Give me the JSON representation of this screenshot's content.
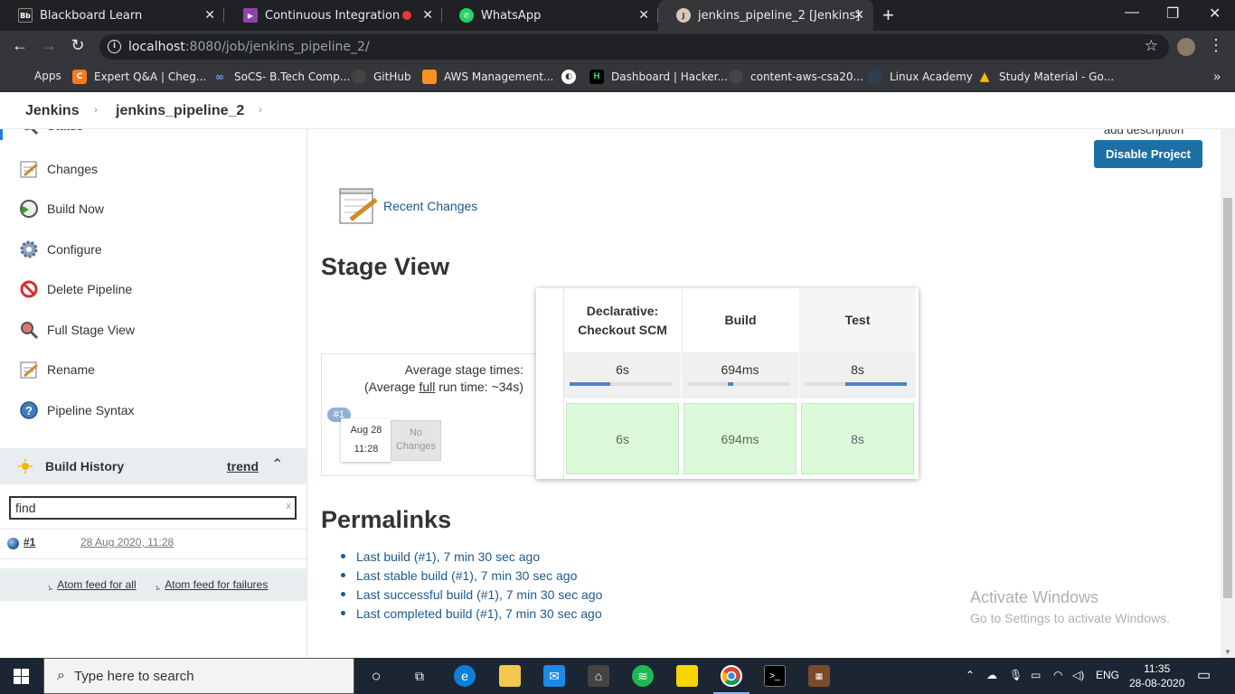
{
  "browser": {
    "tabs": [
      {
        "title": "Blackboard Learn",
        "favicon": "Bb"
      },
      {
        "title": "Continuous Integration & De",
        "favicon": ""
      },
      {
        "title": "WhatsApp",
        "favicon": ""
      },
      {
        "title": "jenkins_pipeline_2 [Jenkins]",
        "favicon": ""
      }
    ],
    "url_host": "localhost",
    "url_rest": ":8080/job/jenkins_pipeline_2/",
    "bookmarks": [
      {
        "label": "Apps"
      },
      {
        "label": "Expert Q&A | Cheg..."
      },
      {
        "label": "SoCS- B.Tech Comp..."
      },
      {
        "label": "GitHub"
      },
      {
        "label": "AWS Management..."
      },
      {
        "label": ""
      },
      {
        "label": "Dashboard | Hacker..."
      },
      {
        "label": "content-aws-csa20..."
      },
      {
        "label": "Linux Academy"
      },
      {
        "label": "Study Material - Go..."
      }
    ]
  },
  "breadcrumb": {
    "root": "Jenkins",
    "job": "jenkins_pipeline_2"
  },
  "sidebar": {
    "items": [
      {
        "label": "Status"
      },
      {
        "label": "Changes"
      },
      {
        "label": "Build Now"
      },
      {
        "label": "Configure"
      },
      {
        "label": "Delete Pipeline"
      },
      {
        "label": "Full Stage View"
      },
      {
        "label": "Rename"
      },
      {
        "label": "Pipeline Syntax"
      }
    ],
    "build_history": {
      "title": "Build History",
      "trend": "trend",
      "find_value": "find",
      "clear": "x",
      "builds": [
        {
          "number": "#1",
          "date": "28 Aug 2020, 11:28"
        }
      ],
      "feed_all": "Atom feed for all",
      "feed_failures": "Atom feed for failures"
    }
  },
  "main": {
    "add_description": "add description",
    "disable_button": "Disable Project",
    "recent_changes": "Recent Changes",
    "stage_view_title": "Stage View",
    "avg_line1": "Average stage times:",
    "avg_line2_a": "(Average ",
    "avg_line2_u": "full",
    "avg_line2_b": " run time: ~34s)",
    "stages": [
      {
        "name_l1": "Declarative:",
        "name_l2": "Checkout SCM",
        "avg": "6s",
        "avg_fraction": 0.4,
        "cell": "6s"
      },
      {
        "name_l1": "Build",
        "name_l2": "",
        "avg": "694ms",
        "avg_fraction": 0.05,
        "cell": "694ms"
      },
      {
        "name_l1": "Test",
        "name_l2": "",
        "avg": "8s",
        "avg_fraction": 0.6,
        "cell": "8s"
      }
    ],
    "run": {
      "badge": "#1",
      "date": "Aug 28",
      "time": "11:28",
      "changes_l1": "No",
      "changes_l2": "Changes"
    },
    "permalinks_title": "Permalinks",
    "permalinks": [
      "Last build (#1), 7 min 30 sec ago",
      "Last stable build (#1), 7 min 30 sec ago",
      "Last successful build (#1), 7 min 30 sec ago",
      "Last completed build (#1), 7 min 30 sec ago"
    ]
  },
  "watermark": {
    "line1": "Activate Windows",
    "line2": "Go to Settings to activate Windows."
  },
  "taskbar": {
    "search_placeholder": "Type here to search",
    "lang": "ENG",
    "time": "11:35",
    "date": "28-08-2020"
  },
  "colors": {
    "jenkins_link": "#1d5a8c",
    "disable_button": "#1d6fa5",
    "stage_success": "#dbf8d9",
    "taskbar": "#1c2633"
  }
}
